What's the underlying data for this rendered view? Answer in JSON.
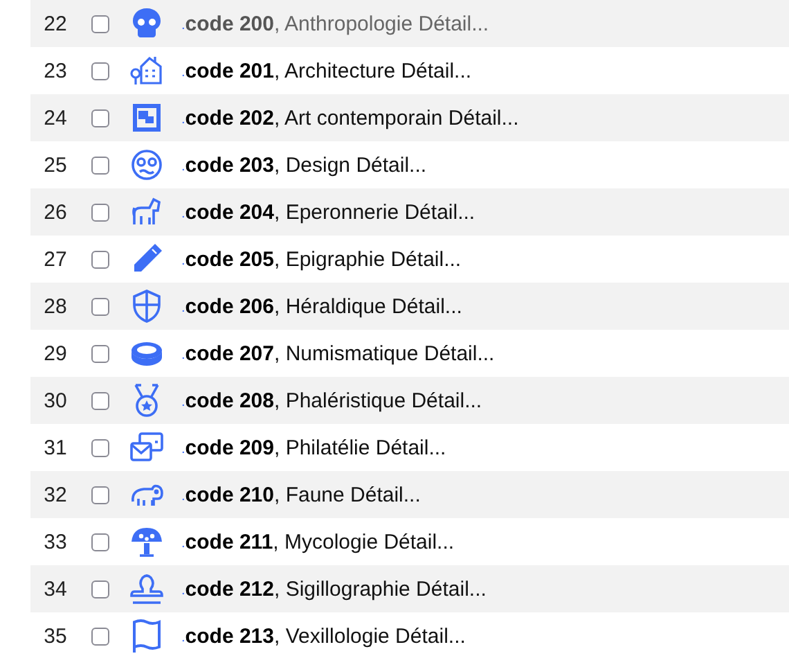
{
  "rows": [
    {
      "number": "22",
      "checked": false,
      "dimmed": true,
      "marker": ".",
      "label": "**code 200**, Anthropologie Détail..."
    },
    {
      "number": "23",
      "checked": false,
      "dimmed": false,
      "marker": ".",
      "label": "**code 201**, Architecture Détail..."
    },
    {
      "number": "24",
      "checked": false,
      "dimmed": false,
      "marker": ".",
      "label": "**code 202**, Art contemporain Détail..."
    },
    {
      "number": "25",
      "checked": false,
      "dimmed": false,
      "marker": ".",
      "label": "**code 203**, Design Détail..."
    },
    {
      "number": "26",
      "checked": false,
      "dimmed": false,
      "marker": ".",
      "label": "**code 204**, Eperonnerie Détail..."
    },
    {
      "number": "27",
      "checked": false,
      "dimmed": false,
      "marker": ".",
      "label": "**code 205**, Epigraphie Détail..."
    },
    {
      "number": "28",
      "checked": false,
      "dimmed": false,
      "marker": ".",
      "label": "**code 206**, Héraldique Détail..."
    },
    {
      "number": "29",
      "checked": false,
      "dimmed": false,
      "marker": ".",
      "label": "**code 207**, Numismatique Détail..."
    },
    {
      "number": "30",
      "checked": false,
      "dimmed": false,
      "marker": ".",
      "label": "**code 208**, Phaléristique Détail..."
    },
    {
      "number": "31",
      "checked": false,
      "dimmed": false,
      "marker": ".",
      "label": "**code 209**, Philatélie Détail..."
    },
    {
      "number": "32",
      "checked": false,
      "dimmed": false,
      "marker": ".",
      "label": "**code 210**, Faune Détail..."
    },
    {
      "number": "33",
      "checked": false,
      "dimmed": false,
      "marker": ".",
      "label": "**code 211**, Mycologie Détail..."
    },
    {
      "number": "34",
      "checked": false,
      "dimmed": false,
      "marker": ".",
      "label": "**code 212**, Sigillographie Détail..."
    },
    {
      "number": "35",
      "checked": false,
      "dimmed": false,
      "marker": ".",
      "label": "**code 213**, Vexillologie Détail..."
    }
  ]
}
